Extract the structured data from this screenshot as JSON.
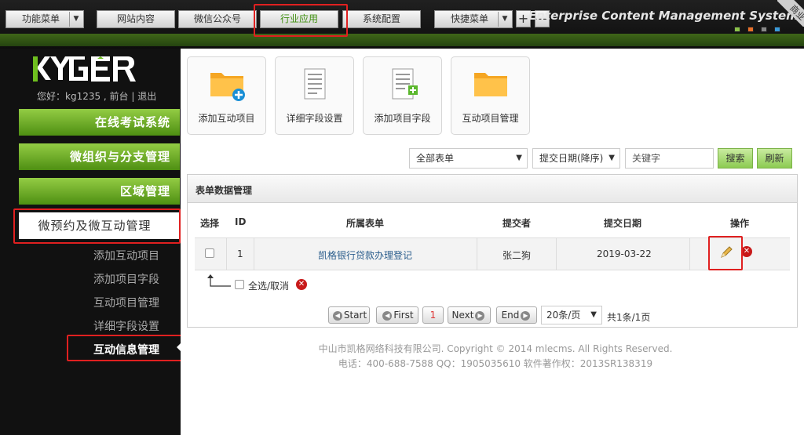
{
  "topnav": {
    "function_menu": "功能菜单",
    "site_content": "网站内容",
    "wechat": "微信公众号",
    "industry": "行业应用",
    "system_config": "系统配置",
    "quick_menu": "快捷菜单",
    "plus": "+",
    "minus": "—",
    "brand": "Enterprise Content Management System",
    "ribbon": "商业",
    "swatches": [
      "#8bc34a",
      "#e8702a",
      "#888888",
      "#3a9ad9"
    ]
  },
  "sidebar": {
    "user_line": "您好：kg1235 , 前台 | 退出",
    "groups": [
      "在线考试系统",
      "微组织与分支管理",
      "区域管理",
      "微预约及微互动管理"
    ],
    "subitems": [
      "添加互动项目",
      "添加项目字段",
      "互动项目管理",
      "详细字段设置",
      "互动信息管理"
    ]
  },
  "tiles": [
    "添加互动项目",
    "详细字段设置",
    "添加项目字段",
    "互动项目管理"
  ],
  "filters": {
    "form_select": "全部表单",
    "sort_select": "提交日期(降序)",
    "keyword_placeholder": "关键字",
    "search": "搜索",
    "refresh": "刷新"
  },
  "panel": {
    "title": "表单数据管理",
    "columns": [
      "选择",
      "ID",
      "所属表单",
      "提交者",
      "提交日期",
      "操作"
    ],
    "rows": [
      {
        "id": "1",
        "form": "凯格银行贷款办理登记",
        "submitter": "张二狗",
        "date": "2019-03-22"
      }
    ],
    "select_all": "全选/取消"
  },
  "pager": {
    "start": "Start",
    "first": "First",
    "page": "1",
    "next": "Next",
    "end": "End",
    "per_page": "20条/页",
    "summary": "共1条/1页"
  },
  "footer": {
    "line1": "中山市凯格网络科技有限公司. Copyright © 2014 mlecms. All Rights Reserved.",
    "line2": "电话：400-688-7588  QQ：1905035610  软件著作权：2013SR138319"
  }
}
